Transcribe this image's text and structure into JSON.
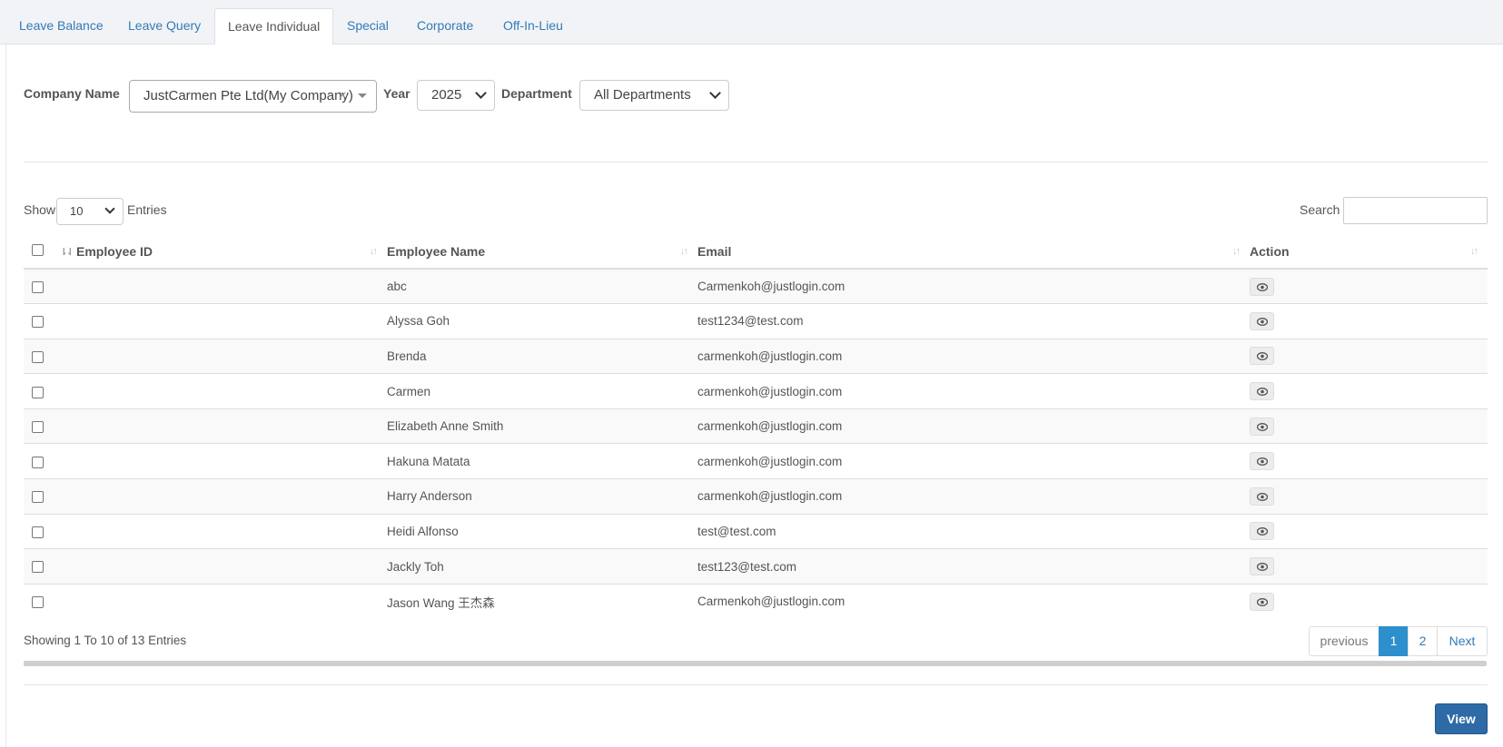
{
  "tabs": [
    {
      "label": "Leave Balance",
      "active": false
    },
    {
      "label": "Leave Query",
      "active": false
    },
    {
      "label": "Leave Individual",
      "active": true
    },
    {
      "label": "Special",
      "active": false
    },
    {
      "label": "Corporate",
      "active": false
    },
    {
      "label": "Off-In-Lieu",
      "active": false
    }
  ],
  "filters": {
    "company_label": "Company Name",
    "company_value": "JustCarmen Pte Ltd(My Company)",
    "clear_symbol": "×",
    "year_label": "Year",
    "year_value": "2025",
    "department_label": "Department",
    "department_value": "All Departments"
  },
  "table_controls": {
    "show_label": "Show",
    "entries_value": "10",
    "entries_label": "Entries",
    "search_label": "Search",
    "search_value": ""
  },
  "columns": [
    "Employee ID",
    "Employee Name",
    "Email",
    "Action"
  ],
  "rows": [
    {
      "id": "",
      "name": "abc",
      "email": "Carmenkoh@justlogin.com"
    },
    {
      "id": "",
      "name": "Alyssa Goh",
      "email": "test1234@test.com"
    },
    {
      "id": "",
      "name": "Brenda",
      "email": "carmenkoh@justlogin.com"
    },
    {
      "id": "",
      "name": "Carmen",
      "email": "carmenkoh@justlogin.com"
    },
    {
      "id": "",
      "name": "Elizabeth Anne Smith",
      "email": "carmenkoh@justlogin.com"
    },
    {
      "id": "",
      "name": "Hakuna Matata",
      "email": "carmenkoh@justlogin.com"
    },
    {
      "id": "",
      "name": "Harry Anderson",
      "email": "carmenkoh@justlogin.com"
    },
    {
      "id": "",
      "name": "Heidi Alfonso",
      "email": "test@test.com"
    },
    {
      "id": "",
      "name": "Jackly Toh",
      "email": "test123@test.com"
    },
    {
      "id": "",
      "name": "Jason Wang 王杰森",
      "email": "Carmenkoh@justlogin.com"
    }
  ],
  "footer": {
    "info": "Showing 1 To 10 of 13 Entries",
    "pagination": {
      "previous": "previous",
      "pages": [
        "1",
        "2"
      ],
      "current": "1",
      "next": "Next"
    },
    "view_button": "View"
  },
  "icons": {
    "row_action": "eye-icon",
    "sort": "sort-icon"
  },
  "colors": {
    "link": "#337ab7",
    "active_page": "#2d8fcb",
    "view_button": "#2d6aa6"
  }
}
